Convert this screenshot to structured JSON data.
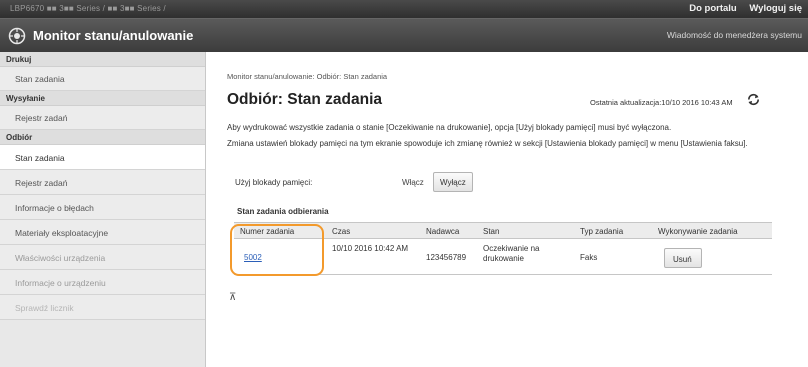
{
  "topbar": {
    "device_name": "LBP6670 ■■ 3■■ Series / ■■ 3■■ Series /",
    "portal_link": "Do portalu",
    "logout_link": "Wyloguj się"
  },
  "header": {
    "title": "Monitor stanu/anulowanie",
    "message_link": "Wiadomość do menedżera systemu"
  },
  "sidebar": {
    "groups": [
      {
        "label": "Drukuj",
        "items": [
          {
            "label": "Stan zadania"
          }
        ]
      },
      {
        "label": "Wysyłanie",
        "items": [
          {
            "label": "Rejestr zadań"
          }
        ]
      },
      {
        "label": "Odbiór",
        "items": [
          {
            "label": "Stan zadania"
          },
          {
            "label": "Rejestr zadań"
          },
          {
            "label": "Informacje o błędach"
          },
          {
            "label": "Materiały eksploatacyjne"
          },
          {
            "label": "Właściwości urządzenia"
          },
          {
            "label": "Informacje o urządzeniu"
          },
          {
            "label": "Sprawdź licznik"
          }
        ]
      }
    ]
  },
  "main": {
    "breadcrumb": "Monitor stanu/anulowanie: Odbiór: Stan zadania",
    "title": "Odbiór: Stan zadania",
    "last_update": "Ostatnia aktualizacja:10/10 2016 10:43 AM",
    "paragraph1": "Aby wydrukować wszystkie zadania o stanie [Oczekiwanie na drukowanie], opcja [Użyj blokady pamięci] musi być wyłączona.",
    "paragraph2": "Zmiana ustawień blokady pamięci na tym ekranie spowoduje ich zmianę również w sekcji [Ustawienia blokady pamięci] w menu [Ustawienia faksu].",
    "memory_lock_label": "Użyj blokady pamięci:",
    "on_button": "Włącz",
    "off_button": "Wyłącz",
    "section_title": "Stan zadania odbierania",
    "table": {
      "headers": [
        "Numer zadania",
        "Czas",
        "Nadawca",
        "Stan",
        "Typ zadania",
        "Wykonywanie zadania"
      ],
      "rows": [
        {
          "job_number": "5002",
          "time": "10/10 2016 10:42 AM",
          "sender": "123456789",
          "status": "Oczekiwanie na drukowanie",
          "type": "Faks",
          "action": "Usuń"
        }
      ]
    },
    "to_top": "⊼"
  },
  "colors": {
    "highlight": "#f39a2c",
    "link": "#2b5fb8",
    "header_bg": "#3c3c3c"
  }
}
